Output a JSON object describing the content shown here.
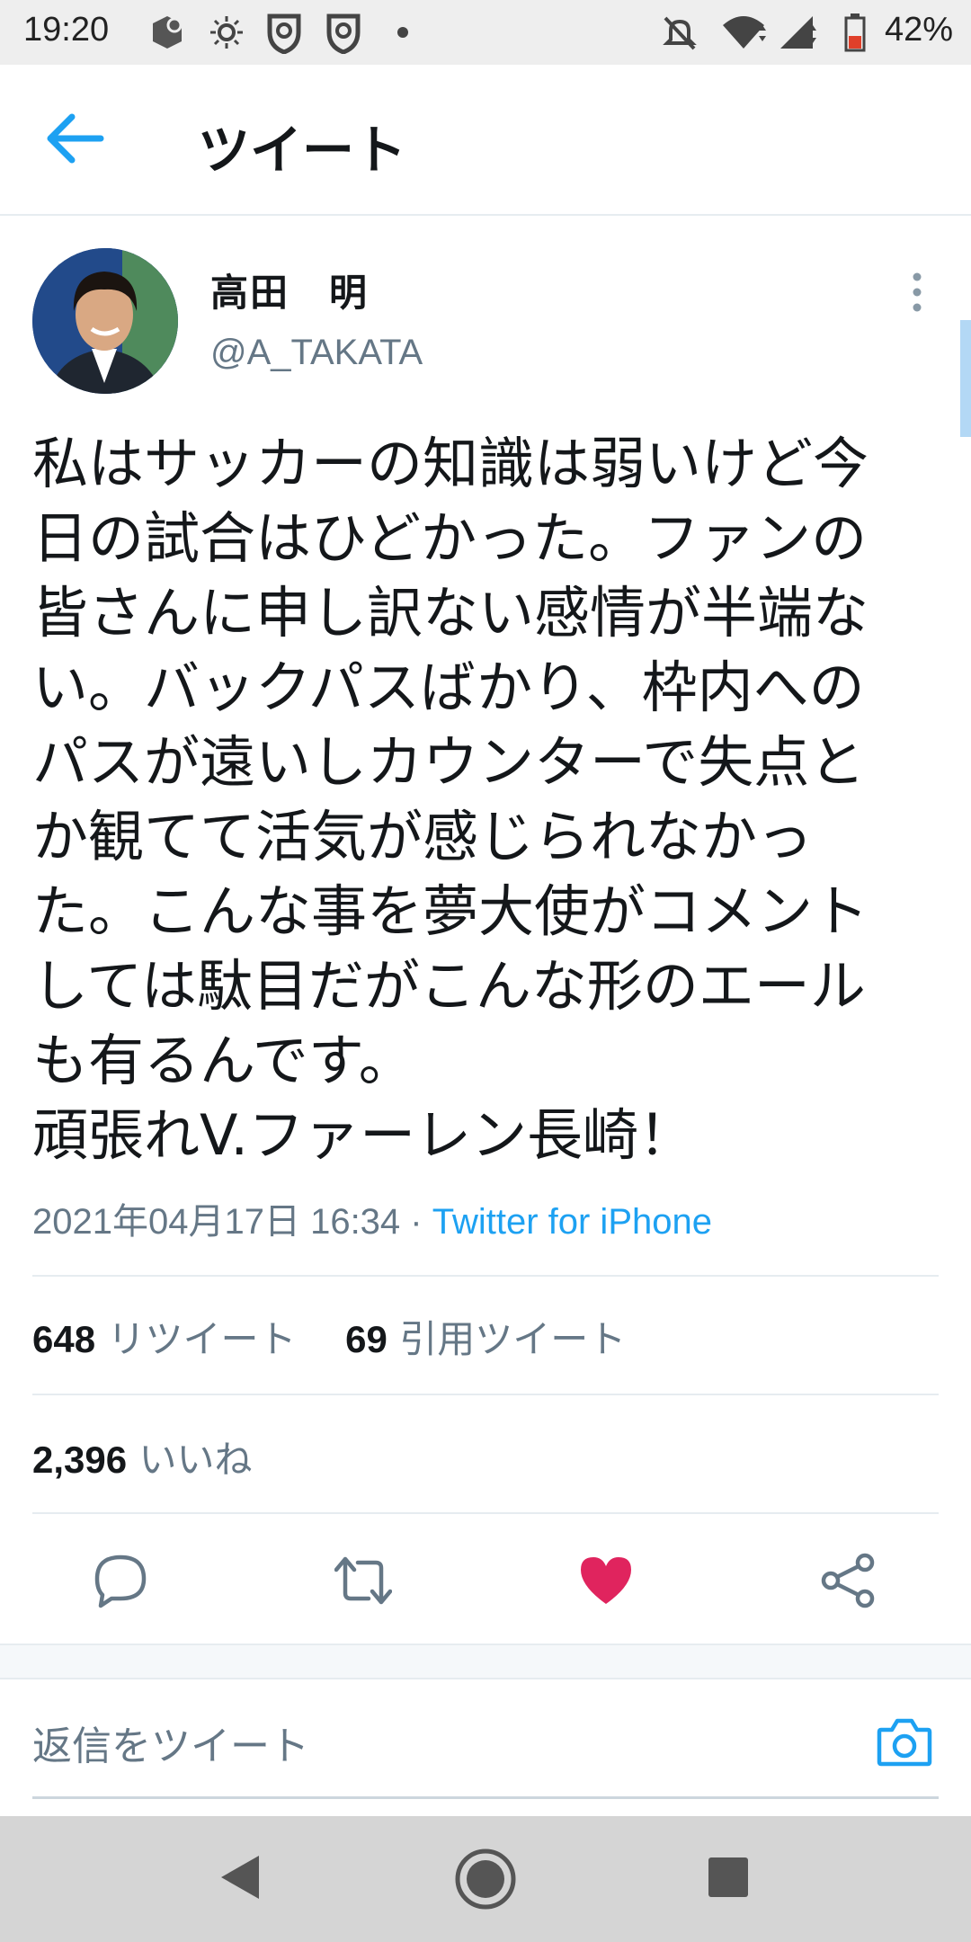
{
  "status_bar": {
    "time": "19:20",
    "battery": "42%",
    "icons": [
      "app-icon",
      "brightness-icon",
      "shield-icon",
      "shield-icon",
      "dot-icon",
      "mute-icon",
      "wifi-icon",
      "signal-icon",
      "battery-icon"
    ]
  },
  "header": {
    "title": "ツイート",
    "back_icon": "arrow-left-icon"
  },
  "author": {
    "name": "高田　明",
    "handle": "@A_TAKATA"
  },
  "tweet": {
    "lines": [
      "私はサッカーの知識は弱いけど今",
      "日の試合はひどかった。ファンの",
      "皆さんに申し訳ない感情が半端な",
      "い。バックパスばかり、枠内への",
      "パスが遠いしカウンターで失点と",
      "か観てて活気が感じられなかっ",
      "た。こんな事を夢大使がコメント",
      "しては駄目だがこんな形のエール",
      "も有るんです。",
      "頑張れV.ファーレン長崎！"
    ],
    "timestamp": "2021年04月17日 16:34",
    "separator": " · ",
    "source": "Twitter for iPhone"
  },
  "stats": {
    "retweets": "648",
    "retweets_label": "リツイート",
    "quotes": "69",
    "quotes_label": "引用ツイート",
    "likes": "2,396",
    "likes_label": "いいね"
  },
  "actions": [
    "reply-icon",
    "retweet-icon",
    "heart-icon",
    "share-icon"
  ],
  "reply": {
    "placeholder": "返信をツイート",
    "camera_icon": "camera-icon"
  },
  "colors": {
    "accent": "#1da1f2",
    "like": "#e0245e",
    "secondary_text": "#657786",
    "status_bar": "#eeeeee",
    "nav_bar": "#d5d5d5"
  }
}
